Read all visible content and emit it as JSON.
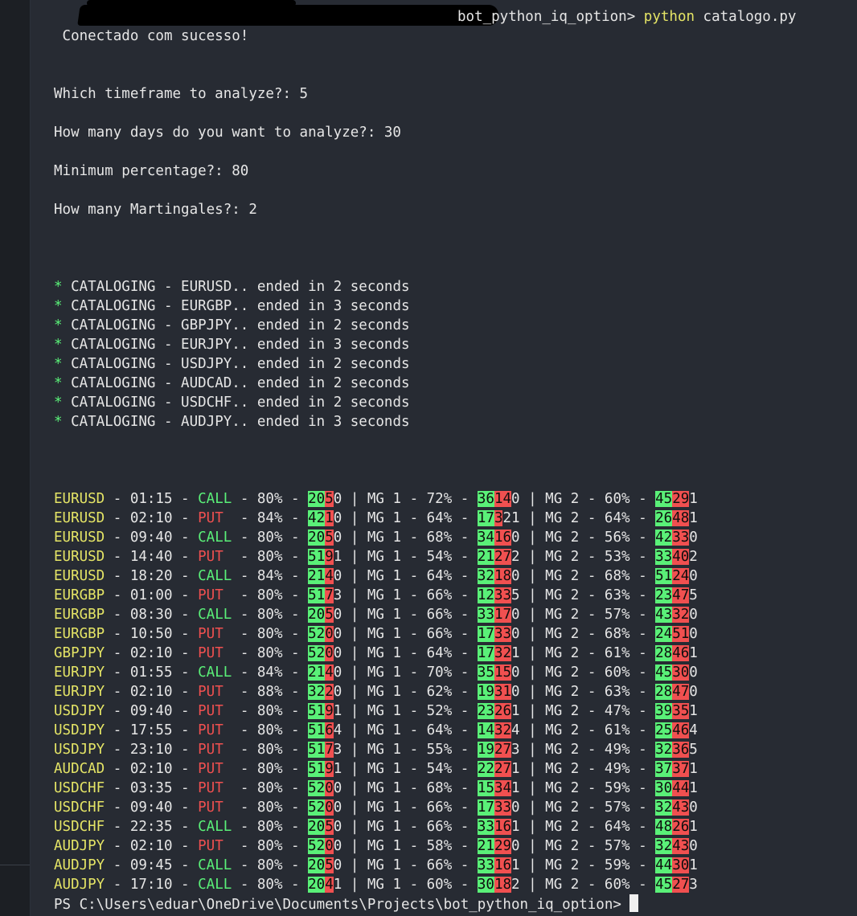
{
  "header": {
    "prompt_tail": "bot_python_iq_option> ",
    "command_exe": "python",
    "command_args": " catalogo.py"
  },
  "connected": " Conectado com sucesso!",
  "questions": [
    "Which timeframe to analyze?: 5",
    "How many days do you want to analyze?: 30",
    "Minimum percentage?: 80",
    "How many Martingales?: 2"
  ],
  "catalog_log": [
    {
      "bullet": "*",
      "text": " CATALOGING - EURUSD.. ended in 2 seconds"
    },
    {
      "bullet": "*",
      "text": " CATALOGING - EURGBP.. ended in 3 seconds"
    },
    {
      "bullet": "*",
      "text": " CATALOGING - GBPJPY.. ended in 2 seconds"
    },
    {
      "bullet": "*",
      "text": " CATALOGING - EURJPY.. ended in 3 seconds"
    },
    {
      "bullet": "*",
      "text": " CATALOGING - USDJPY.. ended in 2 seconds"
    },
    {
      "bullet": "*",
      "text": " CATALOGING - AUDCAD.. ended in 2 seconds"
    },
    {
      "bullet": "*",
      "text": " CATALOGING - USDCHF.. ended in 2 seconds"
    },
    {
      "bullet": "*",
      "text": " CATALOGING - AUDJPY.. ended in 3 seconds"
    }
  ],
  "results": [
    {
      "pair": "EURUSD",
      "time": "01:15",
      "dir": "CALL",
      "pct": "80%",
      "c0": [
        "2",
        "0",
        "5",
        "0"
      ],
      "mg1pct": "72%",
      "c1": [
        "36",
        "14",
        "0"
      ],
      "mg2pct": "60%",
      "c2": [
        "45",
        "29",
        "1"
      ]
    },
    {
      "pair": "EURUSD",
      "time": "02:10",
      "dir": "PUT",
      "pct": "84%",
      "c0": [
        "4",
        "2",
        "1",
        "0"
      ],
      "mg1pct": "64%",
      "c1": [
        "17",
        "3",
        "21"
      ],
      "mg2pct": "64%",
      "c2": [
        "26",
        "48",
        "1"
      ]
    },
    {
      "pair": "EURUSD",
      "time": "09:40",
      "dir": "CALL",
      "pct": "80%",
      "c0": [
        "2",
        "0",
        "5",
        "0"
      ],
      "mg1pct": "68%",
      "c1": [
        "34",
        "16",
        "0"
      ],
      "mg2pct": "56%",
      "c2": [
        "42",
        "33",
        "0"
      ]
    },
    {
      "pair": "EURUSD",
      "time": "14:40",
      "dir": "PUT",
      "pct": "80%",
      "c0": [
        "5",
        "1",
        "9",
        "1"
      ],
      "mg1pct": "54%",
      "c1": [
        "21",
        "27",
        "2"
      ],
      "mg2pct": "53%",
      "c2": [
        "33",
        "40",
        "2"
      ]
    },
    {
      "pair": "EURUSD",
      "time": "18:20",
      "dir": "CALL",
      "pct": "84%",
      "c0": [
        "2",
        "1",
        "4",
        "0"
      ],
      "mg1pct": "64%",
      "c1": [
        "32",
        "18",
        "0"
      ],
      "mg2pct": "68%",
      "c2": [
        "51",
        "24",
        "0"
      ]
    },
    {
      "pair": "EURGBP",
      "time": "01:00",
      "dir": "PUT",
      "pct": "80%",
      "c0": [
        "5",
        "1",
        "7",
        "3"
      ],
      "mg1pct": "66%",
      "c1": [
        "12",
        "33",
        "5"
      ],
      "mg2pct": "63%",
      "c2": [
        "23",
        "47",
        "5"
      ]
    },
    {
      "pair": "EURGBP",
      "time": "08:30",
      "dir": "CALL",
      "pct": "80%",
      "c0": [
        "2",
        "0",
        "5",
        "0"
      ],
      "mg1pct": "66%",
      "c1": [
        "33",
        "17",
        "0"
      ],
      "mg2pct": "57%",
      "c2": [
        "43",
        "32",
        "0"
      ]
    },
    {
      "pair": "EURGBP",
      "time": "10:50",
      "dir": "PUT",
      "pct": "80%",
      "c0": [
        "5",
        "2",
        "0",
        "0"
      ],
      "mg1pct": "66%",
      "c1": [
        "17",
        "33",
        "0"
      ],
      "mg2pct": "68%",
      "c2": [
        "24",
        "51",
        "0"
      ]
    },
    {
      "pair": "GBPJPY",
      "time": "02:10",
      "dir": "PUT",
      "pct": "80%",
      "c0": [
        "5",
        "2",
        "0",
        "0"
      ],
      "mg1pct": "64%",
      "c1": [
        "17",
        "32",
        "1"
      ],
      "mg2pct": "61%",
      "c2": [
        "28",
        "46",
        "1"
      ]
    },
    {
      "pair": "EURJPY",
      "time": "01:55",
      "dir": "CALL",
      "pct": "84%",
      "c0": [
        "2",
        "1",
        "4",
        "0"
      ],
      "mg1pct": "70%",
      "c1": [
        "35",
        "15",
        "0"
      ],
      "mg2pct": "60%",
      "c2": [
        "45",
        "30",
        "0"
      ]
    },
    {
      "pair": "EURJPY",
      "time": "02:10",
      "dir": "PUT",
      "pct": "88%",
      "c0": [
        "3",
        "2",
        "2",
        "0"
      ],
      "mg1pct": "62%",
      "c1": [
        "19",
        "31",
        "0"
      ],
      "mg2pct": "63%",
      "c2": [
        "28",
        "47",
        "0"
      ]
    },
    {
      "pair": "USDJPY",
      "time": "09:40",
      "dir": "PUT",
      "pct": "80%",
      "c0": [
        "5",
        "1",
        "9",
        "1"
      ],
      "mg1pct": "52%",
      "c1": [
        "23",
        "26",
        "1"
      ],
      "mg2pct": "47%",
      "c2": [
        "39",
        "35",
        "1"
      ]
    },
    {
      "pair": "USDJPY",
      "time": "17:55",
      "dir": "PUT",
      "pct": "80%",
      "c0": [
        "5",
        "1",
        "6",
        "4"
      ],
      "mg1pct": "64%",
      "c1": [
        "14",
        "32",
        "4"
      ],
      "mg2pct": "61%",
      "c2": [
        "25",
        "46",
        "4"
      ]
    },
    {
      "pair": "USDJPY",
      "time": "23:10",
      "dir": "PUT",
      "pct": "80%",
      "c0": [
        "5",
        "1",
        "7",
        "3"
      ],
      "mg1pct": "55%",
      "c1": [
        "19",
        "27",
        "3"
      ],
      "mg2pct": "49%",
      "c2": [
        "32",
        "36",
        "5"
      ]
    },
    {
      "pair": "AUDCAD",
      "time": "02:10",
      "dir": "PUT",
      "pct": "80%",
      "c0": [
        "5",
        "1",
        "9",
        "1"
      ],
      "mg1pct": "54%",
      "c1": [
        "22",
        "27",
        "1"
      ],
      "mg2pct": "49%",
      "c2": [
        "37",
        "37",
        "1"
      ]
    },
    {
      "pair": "USDCHF",
      "time": "03:35",
      "dir": "PUT",
      "pct": "80%",
      "c0": [
        "5",
        "2",
        "0",
        "0"
      ],
      "mg1pct": "68%",
      "c1": [
        "15",
        "34",
        "1"
      ],
      "mg2pct": "59%",
      "c2": [
        "30",
        "44",
        "1"
      ]
    },
    {
      "pair": "USDCHF",
      "time": "09:40",
      "dir": "PUT",
      "pct": "80%",
      "c0": [
        "5",
        "2",
        "0",
        "0"
      ],
      "mg1pct": "66%",
      "c1": [
        "17",
        "33",
        "0"
      ],
      "mg2pct": "57%",
      "c2": [
        "32",
        "43",
        "0"
      ]
    },
    {
      "pair": "USDCHF",
      "time": "22:35",
      "dir": "CALL",
      "pct": "80%",
      "c0": [
        "2",
        "0",
        "5",
        "0"
      ],
      "mg1pct": "66%",
      "c1": [
        "33",
        "16",
        "1"
      ],
      "mg2pct": "64%",
      "c2": [
        "48",
        "26",
        "1"
      ]
    },
    {
      "pair": "AUDJPY",
      "time": "02:10",
      "dir": "PUT",
      "pct": "80%",
      "c0": [
        "5",
        "2",
        "0",
        "0"
      ],
      "mg1pct": "58%",
      "c1": [
        "21",
        "29",
        "0"
      ],
      "mg2pct": "57%",
      "c2": [
        "32",
        "43",
        "0"
      ]
    },
    {
      "pair": "AUDJPY",
      "time": "09:45",
      "dir": "CALL",
      "pct": "80%",
      "c0": [
        "2",
        "0",
        "5",
        "0"
      ],
      "mg1pct": "66%",
      "c1": [
        "33",
        "16",
        "1"
      ],
      "mg2pct": "59%",
      "c2": [
        "44",
        "30",
        "1"
      ]
    },
    {
      "pair": "AUDJPY",
      "time": "17:10",
      "dir": "CALL",
      "pct": "80%",
      "c0": [
        "2",
        "0",
        "4",
        "1"
      ],
      "mg1pct": "60%",
      "c1": [
        "30",
        "18",
        "2"
      ],
      "mg2pct": "60%",
      "c2": [
        "45",
        "27",
        "3"
      ]
    }
  ],
  "final_prompt": "PS C:\\Users\\eduar\\OneDrive\\Documents\\Projects\\bot_python_iq_option> ",
  "colors": {
    "green": "#5af078",
    "red": "#f05050",
    "yellow": "#e5e566"
  }
}
